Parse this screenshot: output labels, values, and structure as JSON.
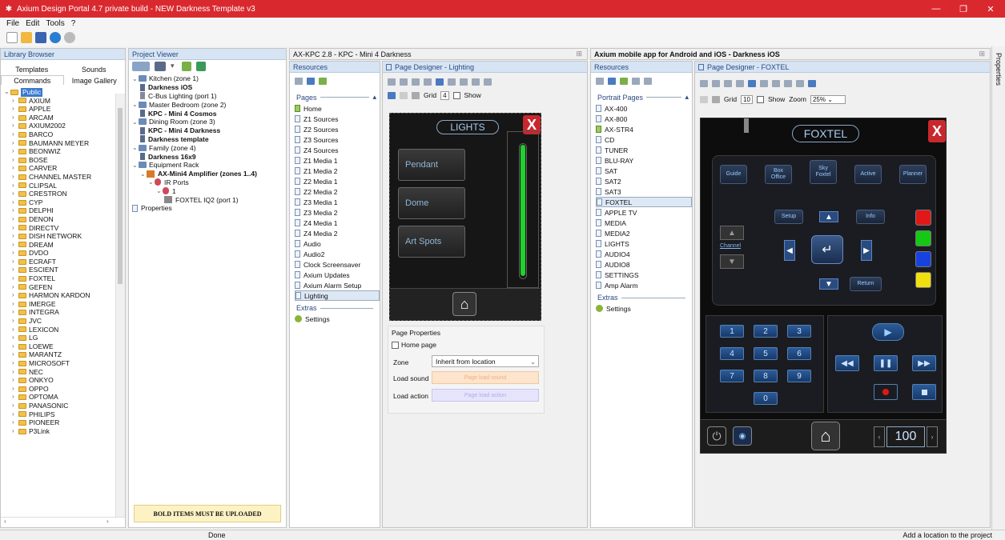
{
  "window": {
    "title": "Axium Design Portal 4.7 private build - NEW Darkness Template v3",
    "accent": "#d9292f"
  },
  "menu": [
    "File",
    "Edit",
    "Tools",
    "?"
  ],
  "library": {
    "title": "Library Browser",
    "tabs_row1": [
      "Templates",
      "Sounds"
    ],
    "tabs_row2": [
      "Commands",
      "Image Gallery"
    ],
    "root": "Public",
    "items": [
      "AXIUM",
      "APPLE",
      "ARCAM",
      "AXIUM2002",
      "BARCO",
      "BAUMANN MEYER",
      "BEONWIZ",
      "BOSE",
      "CARVER",
      "CHANNEL MASTER",
      "CLIPSAL",
      "CRESTRON",
      "CYP",
      "DELPHI",
      "DENON",
      "DIRECTV",
      "DISH NETWORK",
      "DREAM",
      "DVDO",
      "ECRAFT",
      "ESCIENT",
      "FOXTEL",
      "GEFEN",
      "HARMON KARDON",
      "IMERGE",
      "INTEGRA",
      "JVC",
      "LEXICON",
      "LG",
      "LOEWE",
      "MARANTZ",
      "MICROSOFT",
      "NEC",
      "ONKYO",
      "OPPO",
      "OPTOMA",
      "PANASONIC",
      "PHILIPS",
      "PIONEER",
      "P3Link"
    ]
  },
  "project": {
    "title": "Project Viewer",
    "items": [
      {
        "text": "Kitchen (zone 1)",
        "level": 0,
        "type": "zone",
        "bold": false
      },
      {
        "text": "Darkness iOS",
        "level": 1,
        "type": "device",
        "bold": true
      },
      {
        "text": "C-Bus Lighting (port 1)",
        "level": 1,
        "type": "port",
        "bold": false
      },
      {
        "text": "Master Bedroom (zone 2)",
        "level": 0,
        "type": "zone",
        "bold": false
      },
      {
        "text": "KPC - Mini 4 Cosmos",
        "level": 1,
        "type": "device",
        "bold": true
      },
      {
        "text": "Dining Room (zone 3)",
        "level": 0,
        "type": "zone",
        "bold": false
      },
      {
        "text": "KPC - Mini 4 Darkness",
        "level": 1,
        "type": "device",
        "bold": true
      },
      {
        "text": "Darkness template",
        "level": 1,
        "type": "device",
        "bold": true
      },
      {
        "text": "Family (zone 4)",
        "level": 0,
        "type": "zone",
        "bold": false
      },
      {
        "text": "Darkness 16x9",
        "level": 1,
        "type": "device",
        "bold": true
      },
      {
        "text": "Equipment Rack",
        "level": 0,
        "type": "zone",
        "bold": false
      },
      {
        "text": "AX-Mini4 Amplifier (zones 1..4)",
        "level": 1,
        "type": "amp",
        "bold": true
      },
      {
        "text": "IR Ports",
        "level": 2,
        "type": "ir",
        "bold": false
      },
      {
        "text": "1",
        "level": 3,
        "type": "ir",
        "bold": false
      },
      {
        "text": "FOXTEL IQ2 (port 1)",
        "level": 4,
        "type": "dev",
        "bold": false
      },
      {
        "text": "Properties",
        "level": 0,
        "type": "props",
        "bold": false
      }
    ],
    "warning": "BOLD ITEMS MUST BE UPLOADED"
  },
  "doc1": {
    "title": "AX-KPC 2.8 - KPC - Mini 4 Darkness",
    "resources_title": "Resources",
    "pages_label": "Pages",
    "pages": [
      "Home",
      "Z1 Sources",
      "Z2 Sources",
      "Z3 Sources",
      "Z4 Sources",
      "Z1 Media 1",
      "Z1 Media 2",
      "Z2 Media 1",
      "Z2 Media 2",
      "Z3 Media 1",
      "Z3 Media 2",
      "Z4 Media 1",
      "Z4 Media 2",
      "Audio",
      "Audio2",
      "Clock Screensaver",
      "Axium Updates",
      "Axium Alarm Setup",
      "Lighting"
    ],
    "extras_label": "Extras",
    "extras": [
      "Settings"
    ],
    "designer_title": "Page Designer - Lighting",
    "grid_label": "Grid",
    "grid_value": "4",
    "show_label": "Show",
    "screen": {
      "title": "LIGHTS",
      "buttons": [
        "Pendant",
        "Dome",
        "Art Spots"
      ],
      "close": "X"
    },
    "props": {
      "title": "Page Properties",
      "home_page": "Home page",
      "zone_label": "Zone",
      "zone_value": "Inherit from location",
      "load_sound_label": "Load sound",
      "load_sound_btn": "Page load sound",
      "load_action_label": "Load action",
      "load_action_btn": "Page load action"
    }
  },
  "doc2": {
    "title": "Axium mobile app for Android and iOS - Darkness iOS",
    "resources_title": "Resources",
    "pages_label": "Portrait Pages",
    "pages": [
      "AX-400",
      "AX-800",
      "AX-STR4",
      "CD",
      "TUNER",
      "BLU-RAY",
      "SAT",
      "SAT2",
      "SAT3",
      "FOXTEL",
      "APPLE TV",
      "MEDIA",
      "MEDIA2",
      "LIGHTS",
      "AUDIO4",
      "AUDIO8",
      "SETTINGS",
      "Amp Alarm"
    ],
    "extras_label": "Extras",
    "extras": [
      "Settings"
    ],
    "designer_title": "Page Designer - FOXTEL",
    "grid_label": "Grid",
    "grid_value": "10",
    "show_label": "Show",
    "zoom_label": "Zoom",
    "zoom_value": "25%",
    "screen": {
      "title": "FOXTEL",
      "close": "X",
      "top_buttons": [
        "Guide",
        "Box Office",
        "Sky Foxtel",
        "Active",
        "Planner"
      ],
      "nav_buttons": [
        "Setup",
        "Info",
        "Return"
      ],
      "channel_label": "Channel",
      "numbers": [
        "1",
        "2",
        "3",
        "4",
        "5",
        "6",
        "7",
        "8",
        "9",
        "0"
      ],
      "counter": "100"
    }
  },
  "status": {
    "left": "Done",
    "right": "Add a location to the project"
  },
  "properties_tab": "Properties"
}
